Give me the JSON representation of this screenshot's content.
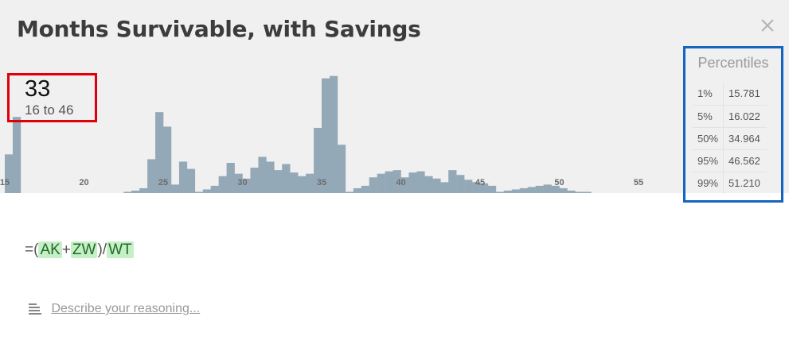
{
  "title": "Months Survivable, with Savings",
  "close_icon": "close-icon",
  "summary": {
    "median": "33",
    "range": "16 to 46"
  },
  "percentiles": {
    "title": "Percentiles",
    "rows": [
      {
        "label": "1%",
        "value": "15.781"
      },
      {
        "label": "5%",
        "value": "16.022"
      },
      {
        "label": "50%",
        "value": "34.964"
      },
      {
        "label": "95%",
        "value": "46.562"
      },
      {
        "label": "99%",
        "value": "51.210"
      }
    ]
  },
  "formula": {
    "open": "=(",
    "var1": "AK",
    "op1": "+",
    "var2": "ZW",
    "op2": ")/",
    "var3": "WT"
  },
  "reasoning": {
    "icon": "text-lines-icon",
    "link_text": "Describe your reasoning..."
  },
  "colors": {
    "bar": "#94a9b8",
    "summary_border": "#e0000a",
    "percentiles_border": "#1565c0",
    "chip_bg": "#c6efc8"
  },
  "chart_data": {
    "type": "bar",
    "title": "",
    "xlabel": "",
    "ylabel": "",
    "x_ticks": [
      15,
      20,
      25,
      30,
      35,
      40,
      45,
      50,
      55
    ],
    "xlim": [
      15,
      57.3
    ],
    "bin_width": 0.5,
    "ylim": [
      0,
      100
    ],
    "x": [
      15.25,
      15.75,
      22.75,
      23.25,
      23.75,
      24.25,
      24.75,
      25.25,
      25.75,
      26.25,
      26.75,
      27.25,
      27.75,
      28.25,
      28.75,
      29.25,
      29.75,
      30.25,
      30.75,
      31.25,
      31.75,
      32.25,
      32.75,
      33.25,
      33.75,
      34.25,
      34.75,
      35.25,
      35.75,
      36.25,
      36.75,
      37.25,
      37.75,
      38.25,
      38.75,
      39.25,
      39.75,
      40.25,
      40.75,
      41.25,
      41.75,
      42.25,
      42.75,
      43.25,
      43.75,
      44.25,
      44.75,
      45.25,
      45.75,
      46.25,
      46.75,
      47.25,
      47.75,
      48.25,
      48.75,
      49.25,
      49.75,
      50.25,
      50.75,
      51.25,
      51.75
    ],
    "values": [
      32,
      63,
      1,
      2,
      4,
      28,
      67,
      55,
      7,
      26,
      20,
      1,
      3,
      6,
      14,
      25,
      16,
      12,
      21,
      30,
      26,
      19,
      24,
      17,
      14,
      16,
      54,
      95,
      97,
      40,
      1,
      4,
      6,
      13,
      16,
      18,
      19,
      13,
      17,
      18,
      14,
      12,
      9,
      19,
      15,
      11,
      9,
      8,
      6,
      1,
      2,
      3,
      4,
      5,
      6,
      7,
      6,
      4,
      2,
      1,
      1
    ]
  }
}
